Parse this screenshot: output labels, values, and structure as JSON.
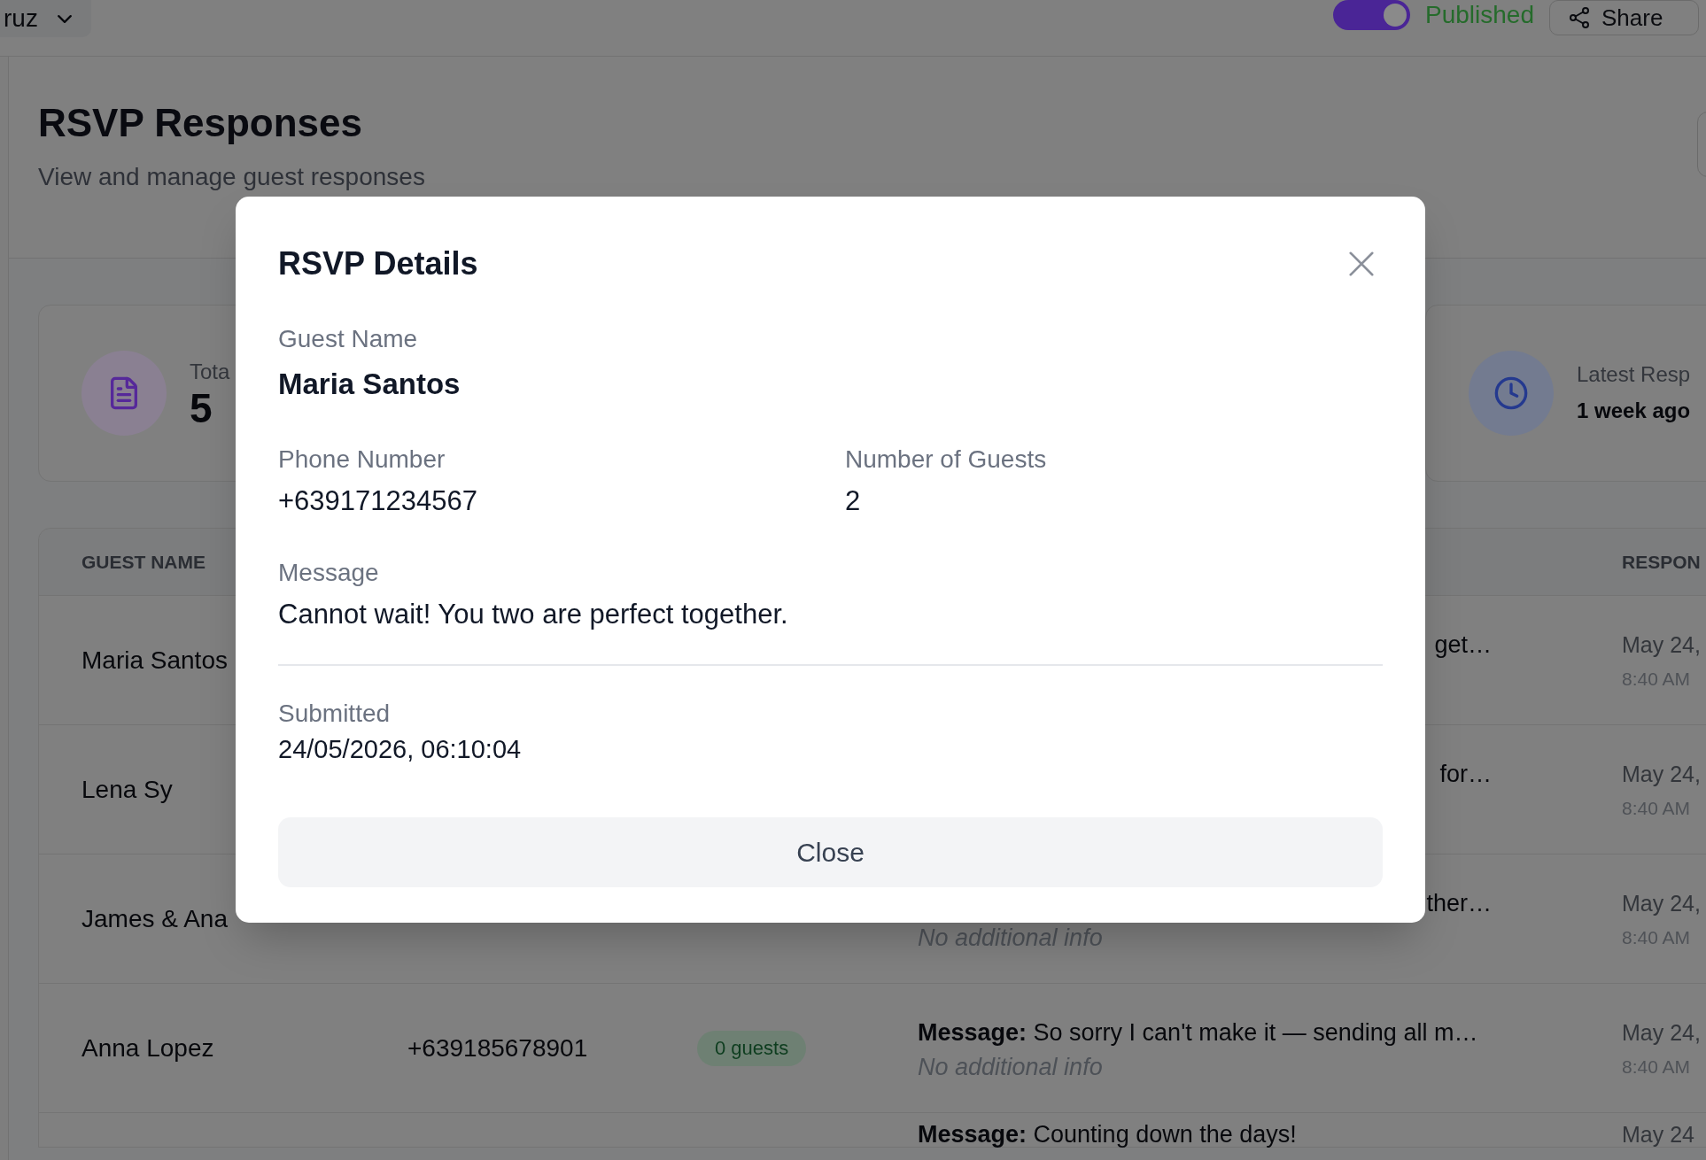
{
  "top_bar": {
    "account_menu": {
      "label": "ruz"
    },
    "publish_toggle": {
      "on": true,
      "label": "Published"
    },
    "share_button": {
      "label": "Share"
    }
  },
  "page_header": {
    "title": "RSVP Responses",
    "subtitle": "View and manage guest responses"
  },
  "stat_cards": [
    {
      "kind": "document",
      "label": "Tota",
      "value": "5"
    },
    {
      "kind": "clock",
      "label": "Latest Resp",
      "value": "1 week ago"
    }
  ],
  "table": {
    "header": {
      "guest_name": "GUEST NAME",
      "column_5": "RESPON"
    },
    "rows": [
      {
        "guest_name": "Maria Santos",
        "message_end": "get…",
        "date": "May 24,",
        "time": "8:40 AM"
      },
      {
        "guest_name": "Lena Sy",
        "message_end": "for…",
        "date": "May 24,",
        "time": "8:40 AM"
      },
      {
        "guest_name": "James & Ana",
        "message_end": "ther…",
        "note": "No additional info",
        "date": "May 24,",
        "time": "8:40 AM"
      },
      {
        "guest_name": "Anna Lopez",
        "phone": "+639185678901",
        "guests": "0 guests",
        "message": "**Message:** So sorry I can't make it — sending all m…",
        "note": "No additional info",
        "date": "May 24,",
        "time": "8:40 AM"
      },
      {
        "message": "**Message:** Counting down the days!",
        "date": "May 24"
      }
    ]
  },
  "dialog": {
    "title": "RSVP Details",
    "guest_name": {
      "label": "Guest Name",
      "value": "Maria Santos"
    },
    "details": [
      {
        "label": "Phone Number",
        "value": "+639171234567"
      },
      {
        "label": "Number of Guests",
        "value": "2"
      }
    ],
    "message": {
      "label": "Message",
      "value": "Cannot wait! You two are perfect together."
    },
    "submitted": {
      "label": "Submitted",
      "value": "24/05/2026, 06:10:04"
    },
    "close_button": {
      "label": "Close"
    }
  }
}
